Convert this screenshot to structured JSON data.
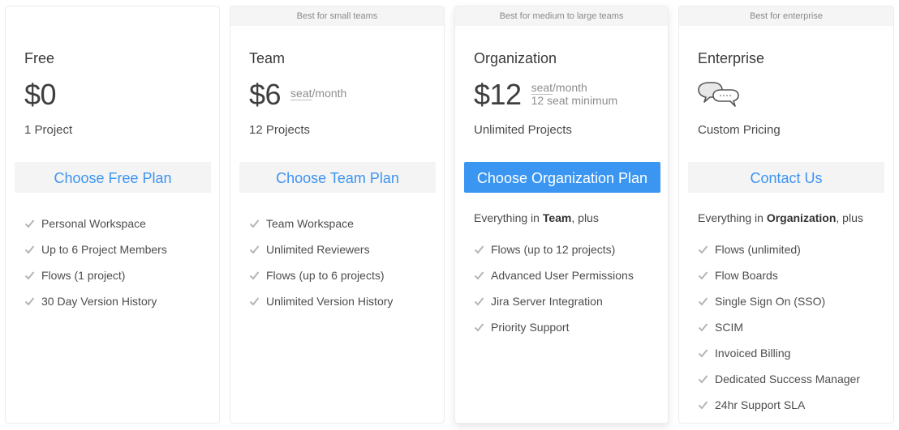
{
  "colors": {
    "accent": "#3b96f2",
    "link": "#3d94f0",
    "ribbon_bg": "#f5f5f5",
    "check": "#b5b5b5"
  },
  "plans": [
    {
      "ribbon": "",
      "name": "Free",
      "price": "$0",
      "subtitle": "1 Project",
      "cta": "Choose Free Plan",
      "features": [
        "Personal Workspace",
        "Up to 6 Project Members",
        "Flows (1 project)",
        "30 Day Version History"
      ]
    },
    {
      "ribbon": "Best for small teams",
      "name": "Team",
      "price": "$6",
      "price_unit_seat": "seat",
      "price_unit_rest": "/month",
      "subtitle": "12 Projects",
      "cta": "Choose Team Plan",
      "features": [
        "Team Workspace",
        "Unlimited Reviewers",
        "Flows (up to 6 projects)",
        "Unlimited Version History"
      ]
    },
    {
      "ribbon": "Best for medium to large teams",
      "name": "Organization",
      "price": "$12",
      "price_unit_seat": "seat",
      "price_unit_rest": "/month",
      "price_note": "12 seat minimum",
      "subtitle": "Unlimited Projects",
      "cta": "Choose Organization Plan",
      "intro_prefix": "Everything in ",
      "intro_bold": "Team",
      "intro_suffix": ", plus",
      "features": [
        "Flows (up to 12 projects)",
        "Advanced User Permissions",
        "Jira Server Integration",
        "Priority Support"
      ]
    },
    {
      "ribbon": "Best for enterprise",
      "name": "Enterprise",
      "icon": "chat-bubbles-icon",
      "subtitle": "Custom Pricing",
      "cta": "Contact Us",
      "intro_prefix": "Everything in ",
      "intro_bold": "Organization",
      "intro_suffix": ", plus",
      "features": [
        "Flows (unlimited)",
        "Flow Boards",
        "Single Sign On (SSO)",
        "SCIM",
        "Invoiced Billing",
        "Dedicated Success Manager",
        "24hr Support SLA"
      ]
    }
  ]
}
